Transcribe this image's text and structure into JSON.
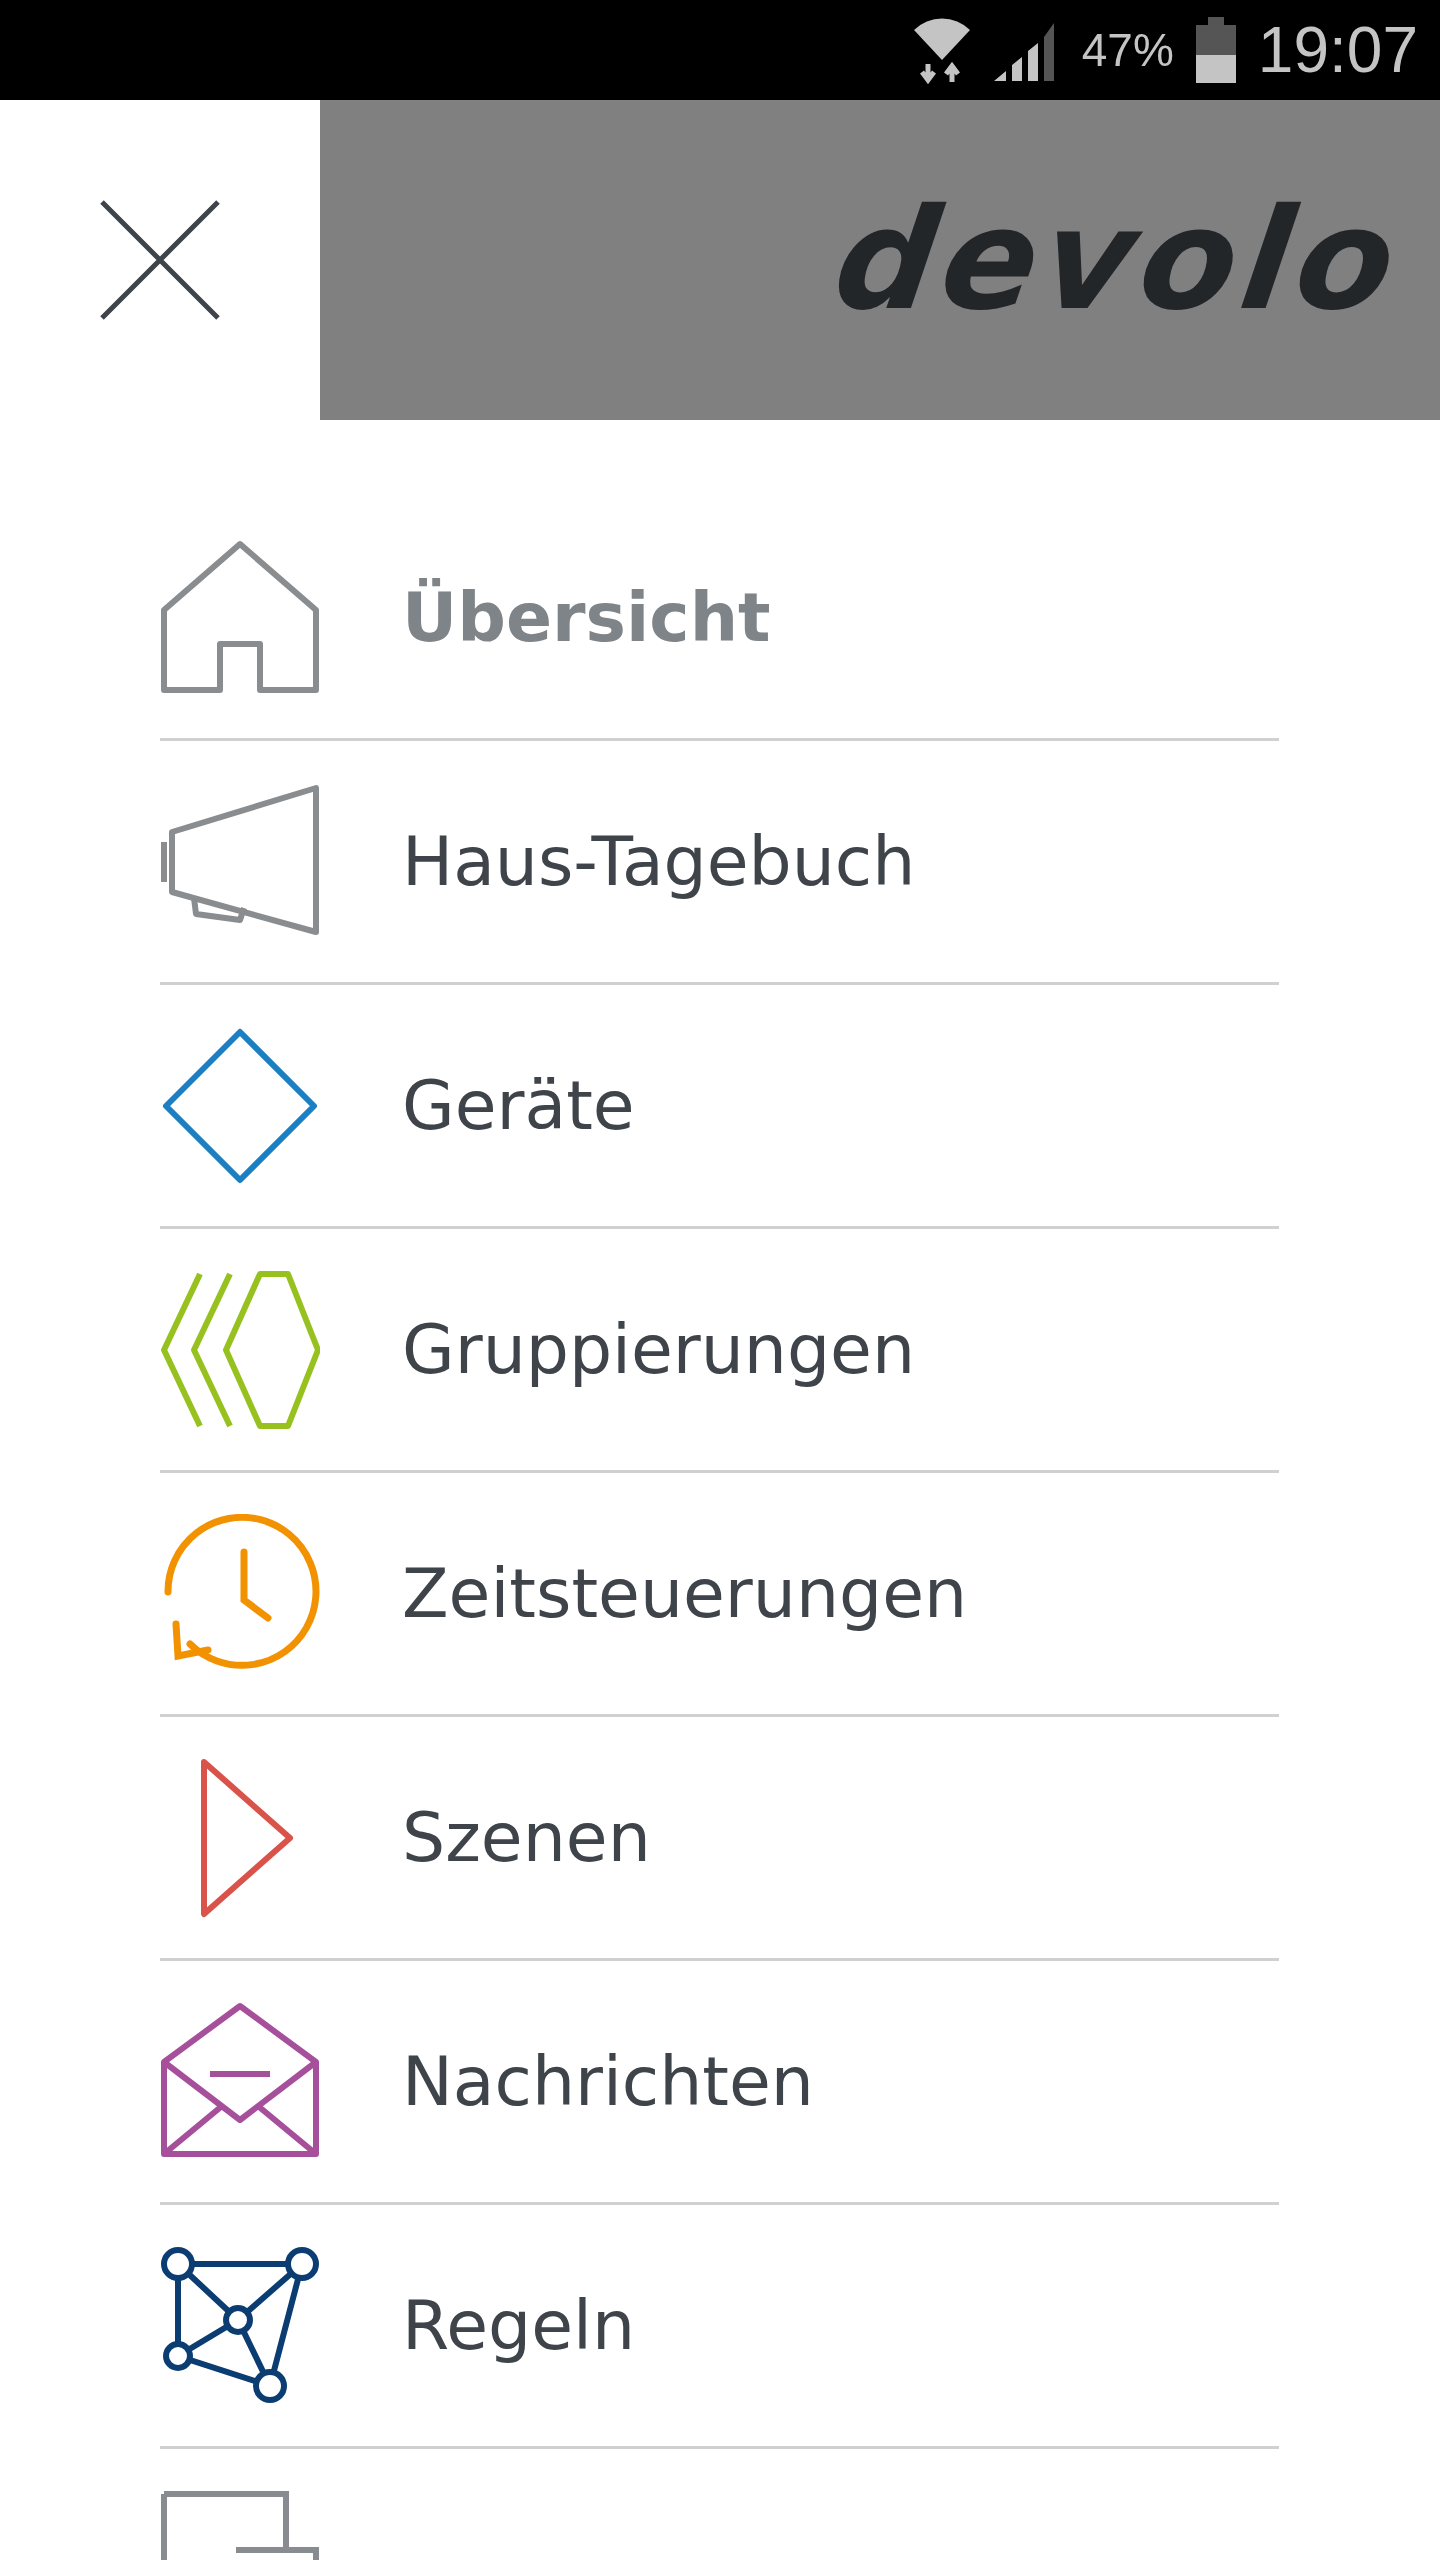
{
  "status_bar": {
    "battery": "47%",
    "time": "19:07"
  },
  "header": {
    "logo": "devolo"
  },
  "menu": [
    {
      "label": "Übersicht",
      "selected": true
    },
    {
      "label": "Haus-Tagebuch",
      "selected": false
    },
    {
      "label": "Geräte",
      "selected": false
    },
    {
      "label": "Gruppierungen",
      "selected": false
    },
    {
      "label": "Zeitsteuerungen",
      "selected": false
    },
    {
      "label": "Szenen",
      "selected": false
    },
    {
      "label": "Nachrichten",
      "selected": false
    },
    {
      "label": "Regeln",
      "selected": false
    }
  ]
}
